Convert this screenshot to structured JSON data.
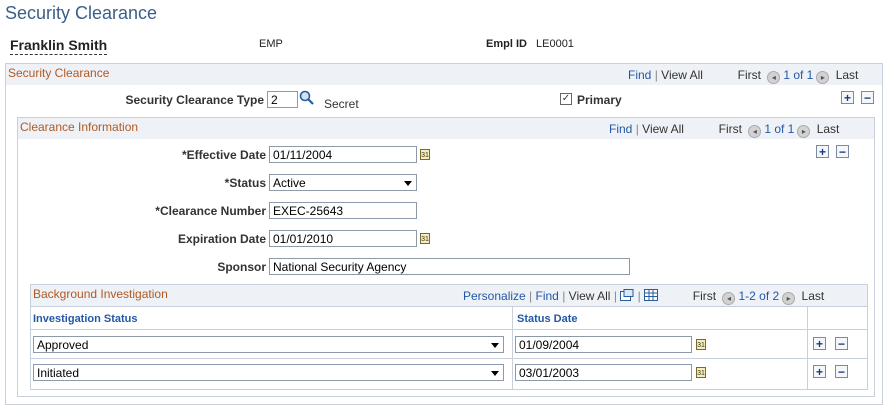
{
  "page": {
    "title": "Security Clearance"
  },
  "employee": {
    "name": "Franklin Smith",
    "type": "EMP",
    "emplid_label": "Empl ID",
    "emplid": "LE0001"
  },
  "security_clearance": {
    "title": "Security Clearance",
    "nav": {
      "find": "Find",
      "view_all": "View All",
      "first": "First",
      "count": "1 of 1",
      "last": "Last"
    },
    "type_label": "Security Clearance Type",
    "type_value": "2",
    "type_desc": "Secret",
    "primary_label": "Primary",
    "primary_checked": true
  },
  "clearance_info": {
    "title": "Clearance Information",
    "nav": {
      "find": "Find",
      "view_all": "View All",
      "first": "First",
      "count": "1 of 1",
      "last": "Last"
    },
    "effective_date_label": "*Effective Date",
    "effective_date": "01/11/2004",
    "status_label": "*Status",
    "status": "Active",
    "clearance_number_label": "*Clearance Number",
    "clearance_number": "EXEC-25643",
    "expiration_date_label": "Expiration Date",
    "expiration_date": "01/01/2010",
    "sponsor_label": "Sponsor",
    "sponsor": "National Security Agency"
  },
  "background": {
    "title": "Background Investigation",
    "nav": {
      "personalize": "Personalize",
      "find": "Find",
      "view_all": "View All",
      "first": "First",
      "count": "1-2 of 2",
      "last": "Last"
    },
    "col_status": "Investigation Status",
    "col_date": "Status Date",
    "rows": [
      {
        "status": "Approved",
        "date": "01/09/2004"
      },
      {
        "status": "Initiated",
        "date": "03/01/2003"
      }
    ]
  },
  "icons": {
    "add": "+",
    "delete": "−",
    "calendar": "31",
    "prev": "◂",
    "next": "▸",
    "check": "✓"
  }
}
